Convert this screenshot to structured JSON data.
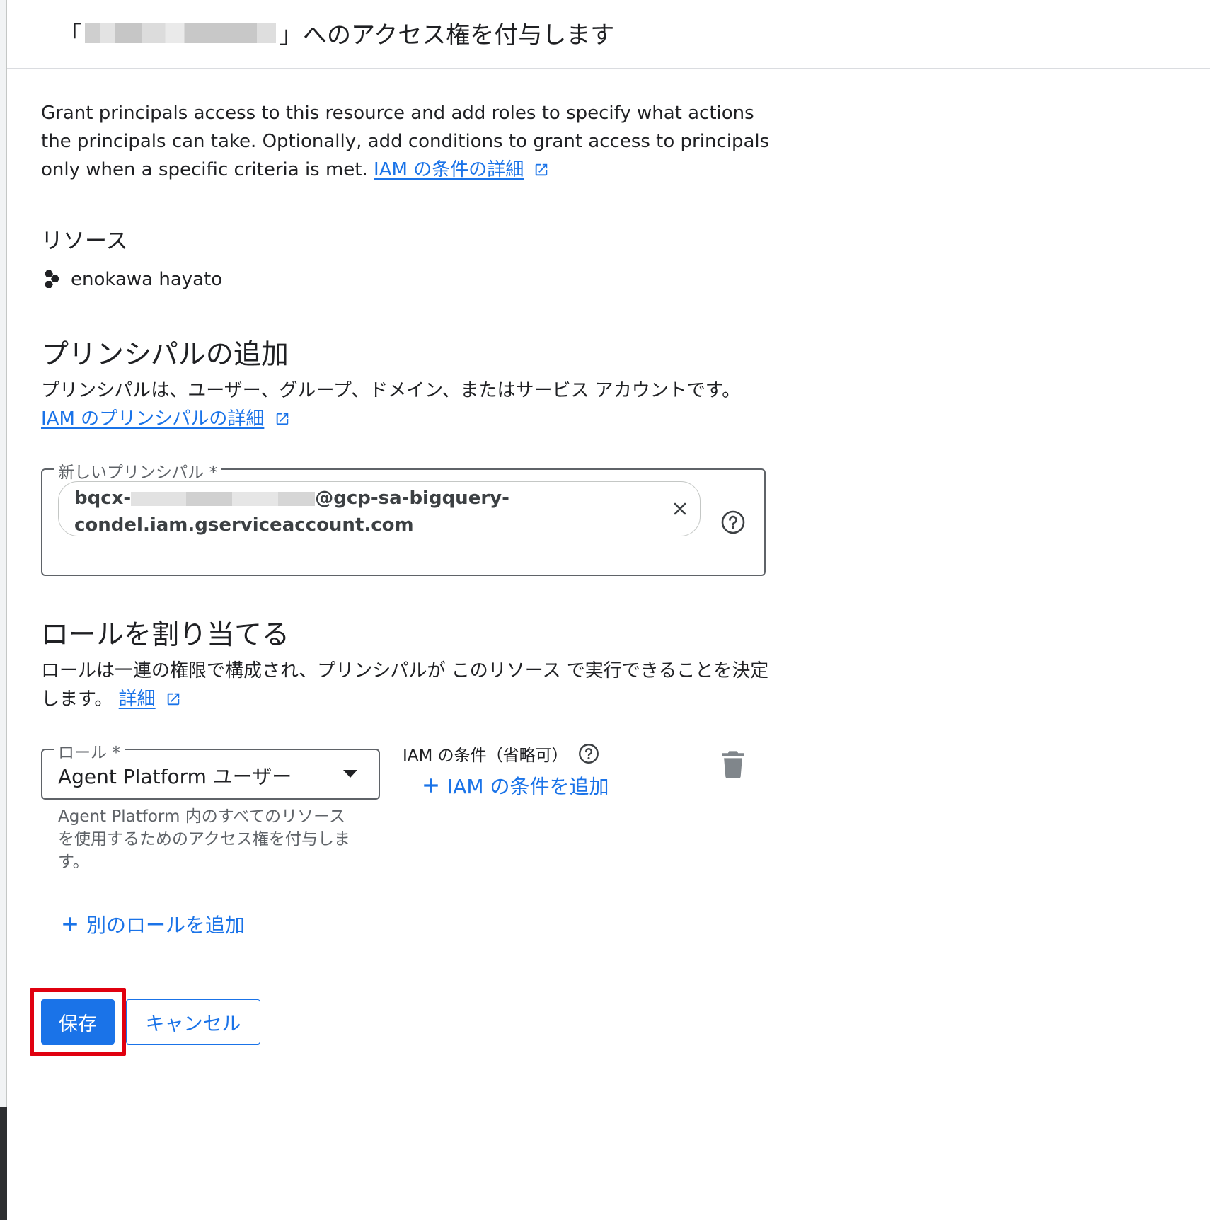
{
  "header": {
    "title_open": "「",
    "title_close": "」へのアクセス権を付与します"
  },
  "intro": {
    "text": "Grant principals access to this resource and add roles to specify what actions the principals can take. Optionally, add conditions to grant access to principals only when a specific criteria is met.",
    "link": "IAM の条件の詳細"
  },
  "resource": {
    "label": "リソース",
    "name": "enokawa hayato"
  },
  "add_principals": {
    "title": "プリンシパルの追加",
    "desc": "プリンシパルは、ユーザー、グループ、ドメイン、またはサービス アカウントです。",
    "link": "IAM のプリンシパルの詳細",
    "field_label": "新しいプリンシパル *",
    "chip_prefix": "bqcx-",
    "chip_suffix": "@gcp-sa-bigquery-",
    "chip_line2": "condel.iam.gserviceaccount.com"
  },
  "assign_roles": {
    "title": "ロールを割り当てる",
    "desc": "ロールは一連の権限で構成され、プリンシパルが このリソース で実行できることを決定します。",
    "link": "詳細",
    "role_label": "ロール *",
    "role_value": "Agent Platform ユーザー",
    "role_help": "Agent Platform 内のすべてのリソースを使用するためのアクセス権を付与します。",
    "condition_label": "IAM の条件（省略可）",
    "add_condition": "IAM の条件を追加",
    "add_role": "別のロールを追加"
  },
  "actions": {
    "save": "保存",
    "cancel": "キャンセル"
  },
  "colors": {
    "accent": "#1a73e8",
    "highlight": "#e0000f"
  }
}
